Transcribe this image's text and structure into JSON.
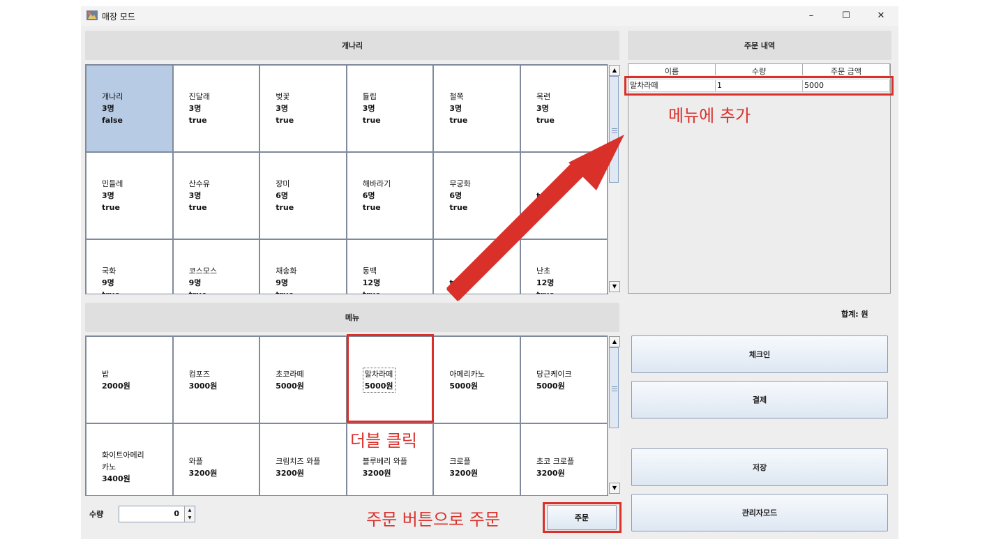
{
  "window": {
    "title": "매장 모드",
    "minimize": "–",
    "maximize": "☐",
    "close": "✕"
  },
  "tables_panel": {
    "header": "개나리",
    "cells": [
      {
        "name": "개나리",
        "people": "3명",
        "status": "false",
        "selected": true
      },
      {
        "name": "진달래",
        "people": "3명",
        "status": "true"
      },
      {
        "name": "벚꽃",
        "people": "3명",
        "status": "true"
      },
      {
        "name": "튤립",
        "people": "3명",
        "status": "true"
      },
      {
        "name": "철쭉",
        "people": "3명",
        "status": "true"
      },
      {
        "name": "목련",
        "people": "3명",
        "status": "true"
      },
      {
        "name": "민들레",
        "people": "3명",
        "status": "true"
      },
      {
        "name": "산수유",
        "people": "3명",
        "status": "true"
      },
      {
        "name": "장미",
        "people": "6명",
        "status": "true"
      },
      {
        "name": "해바라기",
        "people": "6명",
        "status": "true"
      },
      {
        "name": "무궁화",
        "people": "6명",
        "status": "true"
      },
      {
        "name": "",
        "people": "",
        "status": "true"
      },
      {
        "name": "국화",
        "people": "9명",
        "status": "true"
      },
      {
        "name": "코스모스",
        "people": "9명",
        "status": "true"
      },
      {
        "name": "채송화",
        "people": "9명",
        "status": "true"
      },
      {
        "name": "동백",
        "people": "12명",
        "status": "true"
      },
      {
        "name": "",
        "people": "",
        "status": "true"
      },
      {
        "name": "난초",
        "people": "12명",
        "status": "true"
      }
    ]
  },
  "menu_panel": {
    "header": "메뉴",
    "items": [
      {
        "name": "밥",
        "price": "2000원"
      },
      {
        "name": "컴포즈",
        "price": "3000원"
      },
      {
        "name": "초코라떼",
        "price": "5000원"
      },
      {
        "name": "말차라떼",
        "price": "5000원",
        "focused": true
      },
      {
        "name": "아메리카노",
        "price": "5000원"
      },
      {
        "name": "당근케이크",
        "price": "5000원"
      },
      {
        "name": "화이트아메리\n카노",
        "price": "3400원"
      },
      {
        "name": "와플",
        "price": "3200원"
      },
      {
        "name": "크림치즈 와플",
        "price": "3200원"
      },
      {
        "name": "블루베리 와플",
        "price": "3200원"
      },
      {
        "name": "크로플",
        "price": "3200원"
      },
      {
        "name": "초코 크로플",
        "price": "3200원"
      }
    ]
  },
  "order_panel": {
    "header": "주문 내역",
    "columns": [
      "이름",
      "수량",
      "주문 금액"
    ],
    "rows": [
      {
        "name": "말차라떼",
        "qty": "1",
        "amount": "5000"
      }
    ],
    "total_label": "합계: 원"
  },
  "quantity": {
    "label": "수량",
    "value": "0"
  },
  "buttons": {
    "order": "주문",
    "checkin": "체크인",
    "pay": "결제",
    "save": "저장",
    "admin": "관리자모드"
  },
  "annotations": {
    "add_to_menu": "메뉴에 추가",
    "double_click": "더블 클릭",
    "order_with_button": "주문 버튼으로 주문",
    "accent_color": "#d9302a"
  },
  "colors": {
    "selected_cell": "#b8cbe4",
    "window_bg": "#eeeeee"
  }
}
